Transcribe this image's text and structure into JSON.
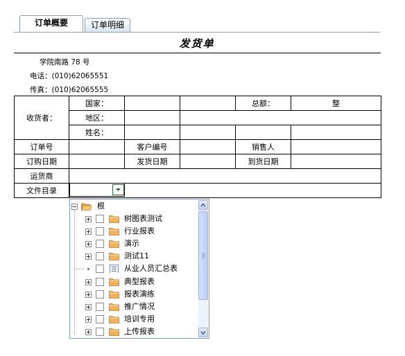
{
  "tabs": [
    {
      "label": "订单概要",
      "active": true
    },
    {
      "label": "订单明细",
      "active": false
    }
  ],
  "title": "发货单",
  "address": "学院南路 78 号",
  "phone_label": "电话：",
  "phone": "(010)62065551",
  "fax_label": "传真：",
  "fax": "(010)62065555",
  "form": {
    "consignee": "收货者：",
    "country": "国家：",
    "region": "地区：",
    "name": "姓名：",
    "total": "总额：",
    "total_value": "整",
    "order_no": "订单号",
    "customer_no": "客户编号",
    "salesperson": "销售人",
    "order_date": "订购日期",
    "ship_date": "发货日期",
    "arrive_date": "到货日期",
    "shipper": "运货商",
    "file_dir": "文件目录"
  },
  "tree": {
    "root": "根",
    "items": [
      {
        "label": "树图表测试",
        "type": "folder"
      },
      {
        "label": "行业报表",
        "type": "folder"
      },
      {
        "label": "演示",
        "type": "folder"
      },
      {
        "label": "测试11",
        "type": "folder"
      },
      {
        "label": "从业人员汇总表",
        "type": "report"
      },
      {
        "label": "典型报表",
        "type": "folder"
      },
      {
        "label": "报表演练",
        "type": "folder"
      },
      {
        "label": "推广情况",
        "type": "folder"
      },
      {
        "label": "培训专用",
        "type": "folder"
      },
      {
        "label": "上传报表",
        "type": "folder"
      }
    ]
  },
  "colors": {
    "folder": "#f0b35a",
    "scrollbar": "#c3d5f4",
    "combo_button_border": "#2d6b3a"
  }
}
